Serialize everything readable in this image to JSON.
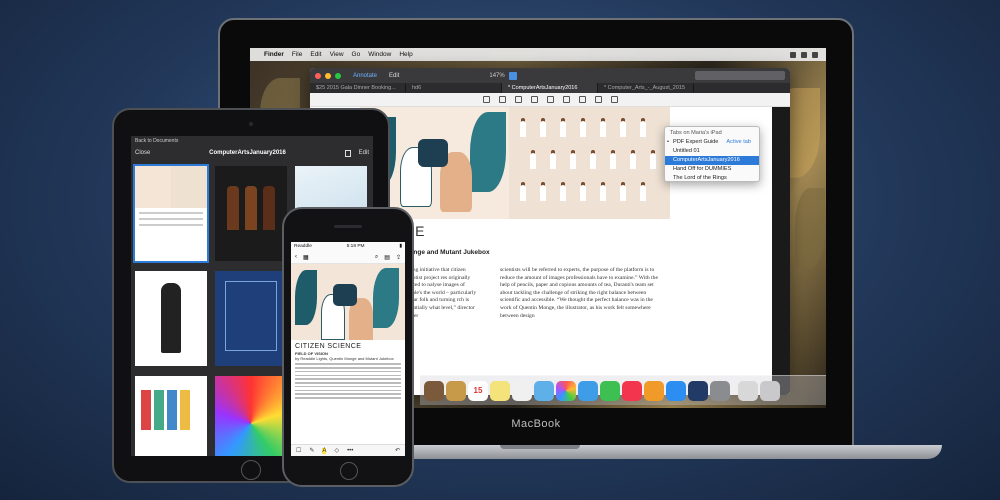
{
  "macbook": {
    "brand": "MacBook",
    "menubar": {
      "apple": "",
      "items": [
        "Finder",
        "File",
        "Edit",
        "View",
        "Go",
        "Window",
        "Help"
      ]
    },
    "pdf_window": {
      "toolbar": {
        "annotate": "Annotate",
        "edit": "Edit",
        "zoom": "147%"
      },
      "tabs": [
        "$25 2015 Gala Dinner Booking...",
        "hd6",
        "* ComputerArtsJanuary2016",
        "* Computer_Arts_-_August_2015"
      ],
      "page": {
        "heading": "CE",
        "subheading": "Monge and Mutant Jukebox",
        "col_a": "urcing initiative that citizen scientist project res originally created to nalyse images of people's the world – particularly egular folk and turning rch is essentially what level,” director Oliver",
        "col_b": "scientists will be referred to experts, the purpose of the platform is to reduce the amount of images professionals have to examine.” With the help of pencils, paper and copious amounts of tea, Duranti's team set about tackling the challenge of striking the right balance between scientific and accessible. “We thought the perfect balance was in the work of Quentin Monge, the illustrator, as his work felt somewhere between design"
      },
      "dropdown": {
        "header": "Tabs on Maria's iPad",
        "active_label": "Active tab",
        "items": [
          {
            "label": "PDF Expert Guide",
            "checked": true
          },
          {
            "label": "Untitled 01"
          },
          {
            "label": "ComputerArtsJanuary2016",
            "selected": true
          },
          {
            "label": "Hand Off for DUMMIES"
          },
          {
            "label": "The Lord of the Rings"
          }
        ]
      }
    },
    "dock": {
      "calendar_day": "15",
      "icons": [
        "finder-icon",
        "launchpad-icon",
        "safari-icon",
        "mail-icon",
        "contacts-icon",
        "calendar-icon",
        "notes-icon",
        "reminders-icon",
        "maps-icon",
        "photos-icon",
        "messages-icon",
        "facetime-icon",
        "music-icon",
        "books-icon",
        "appstore-icon",
        "quicktime-icon",
        "settings-icon",
        "preview-icon",
        "trash-icon"
      ]
    }
  },
  "ipad": {
    "status_left": "Back to Documents",
    "close": "Close",
    "title": "ComputerArtsJanuary2016",
    "edit": "Edit"
  },
  "iphone": {
    "carrier": "Readdle",
    "time": "5:18 PM",
    "heading": "CITIZEN SCIENCE",
    "sub1": "FIELD OF VISION",
    "sub2": "by Readdle Lights, Quentin Monge and Mutant Jukebox"
  },
  "colors": {
    "accent": "#2d7bd8",
    "background": "#22385a"
  }
}
